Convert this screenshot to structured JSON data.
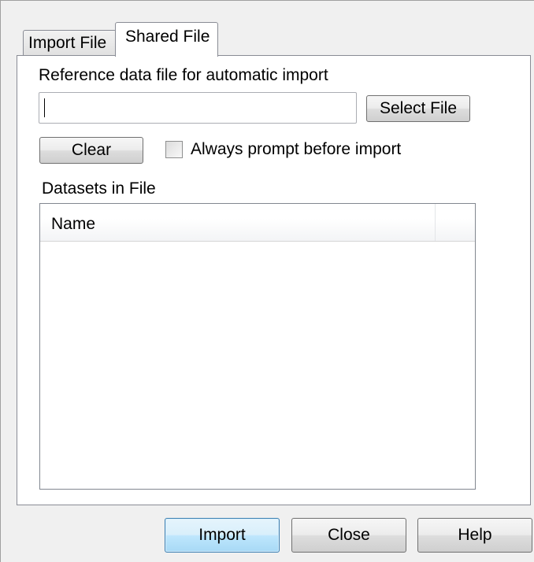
{
  "tabs": [
    {
      "label": "Import File",
      "selected": false
    },
    {
      "label": "Shared File",
      "selected": true
    }
  ],
  "shared_file": {
    "reference_label": "Reference data file for automatic import",
    "file_path_value": "",
    "select_file_label": "Select File",
    "clear_label": "Clear",
    "always_prompt_label": "Always prompt before import",
    "always_prompt_checked": false,
    "datasets_label": "Datasets in File",
    "datasets_columns": [
      "Name"
    ],
    "datasets_rows": []
  },
  "dialog_buttons": {
    "import_label": "Import",
    "close_label": "Close",
    "help_label": "Help"
  }
}
